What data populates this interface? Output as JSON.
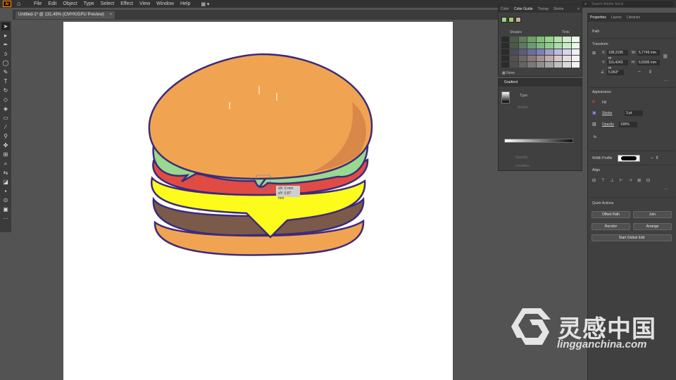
{
  "app": {
    "logo_text": "Ai"
  },
  "menu": [
    "File",
    "Edit",
    "Object",
    "Type",
    "Select",
    "Effect",
    "View",
    "Window",
    "Help"
  ],
  "search_placeholder": "Search Adobe Stock",
  "document_tab": {
    "title": "Untitled-1* @ 131,49% (CMYK/GPU Preview)",
    "close": "×"
  },
  "measure_tooltip": {
    "dx": "dX: 0 mm",
    "dy": "dY: 0,87 mm"
  },
  "color_guide": {
    "tabs": [
      "Color",
      "Color Guide",
      "Transp",
      "Stroke"
    ],
    "active_tab": "Color Guide",
    "shades_label": "Shades",
    "tints_label": "Tints",
    "footer": "None",
    "harmony": [
      "#96d48a",
      "#a2c96e",
      "#c9b08e"
    ],
    "grid": [
      [
        "#2b2b2b",
        "#4c5a4c",
        "#5e7d5b",
        "#6f9f6a",
        "#7fbf78",
        "#96d48a",
        "#b7e2ad",
        "#d3eecd",
        "#eef8ec"
      ],
      [
        "#2b2b2b",
        "#4a584a",
        "#5d7a63",
        "#6c9a70",
        "#7db67e",
        "#8fcc8d",
        "#acdca9",
        "#cbebc8",
        "#e9f6e7"
      ],
      [
        "#2b2b2b",
        "#4b4b5a",
        "#5c5c7a",
        "#6d6d99",
        "#7f7fb8",
        "#a09fcf",
        "#bdbce0",
        "#d6d5ec",
        "#efeff8"
      ],
      [
        "#2b2b2b",
        "#555050",
        "#6e6565",
        "#887979",
        "#a39191",
        "#bfaeae",
        "#d5c9c9",
        "#e6dede",
        "#f5f1f1"
      ],
      [
        "#2b2b2b",
        "#4f4f4f",
        "#636363",
        "#787878",
        "#8e8e8e",
        "#a6a6a6",
        "#c0c0c0",
        "#d9d9d9",
        "#f1f1f1"
      ]
    ]
  },
  "gradient": {
    "title": "Gradient",
    "type_label": "Type:",
    "stroke_label": "Stroke:",
    "opacity_label": "Opacity:",
    "location_label": "Location:"
  },
  "properties": {
    "tabs": [
      "Properties",
      "Layers",
      "Libraries"
    ],
    "object_type": "Path",
    "transform": {
      "title": "Transform",
      "x": "108,2195 m",
      "y": "115,4243 m",
      "w": "5,7749 mm",
      "h": "6,6936 mm",
      "angle": "5,963°",
      "x_label": "X:",
      "y_label": "Y:",
      "w_label": "W:",
      "h_label": "H:"
    },
    "appearance": {
      "title": "Appearance",
      "fill_label": "Fill",
      "stroke_label": "Stroke",
      "stroke_value": "3 pt",
      "opacity_label": "Opacity",
      "opacity_value": "100%",
      "fx": "fx."
    },
    "width_profile": "Width Profile",
    "align": "Align",
    "quick_actions": {
      "title": "Quick Actions",
      "offset_path": "Offset Path",
      "join": "Join",
      "recolor": "Recolor",
      "arrange": "Arrange",
      "start_global_edit": "Start Global Edit"
    }
  },
  "watermark": {
    "title": "灵感中国",
    "url": "lingganchina.com"
  },
  "colors": {
    "bun": "#f0a452",
    "bun_shadow": "#d9884a",
    "lettuce": "#96d98f",
    "tomato": "#e04c44",
    "cheese": "#fdfb1b",
    "patty": "#7b5a4a",
    "outline": "#3d2b7a"
  }
}
